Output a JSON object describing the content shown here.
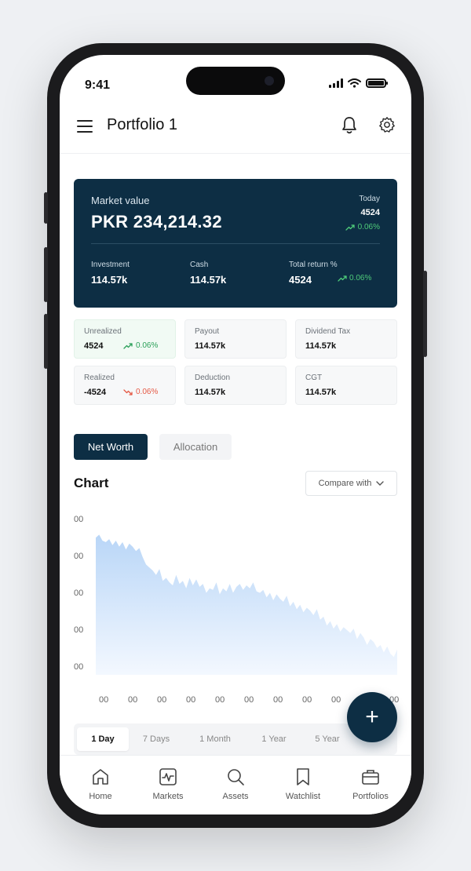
{
  "status_bar": {
    "time": "9:41"
  },
  "header": {
    "title": "Portfolio 1"
  },
  "market_card": {
    "label": "Market value",
    "value": "PKR 234,214.32",
    "today_label": "Today",
    "today_value": "4524",
    "today_change": "0.06%",
    "investment_label": "Investment",
    "investment_value": "114.57k",
    "cash_label": "Cash",
    "cash_value": "114.57k",
    "total_return_label": "Total return %",
    "total_return_value": "4524",
    "total_return_change": "0.06%"
  },
  "stats": [
    {
      "label": "Unrealized",
      "value": "4524",
      "change": "0.06%",
      "trend": "up"
    },
    {
      "label": "Payout",
      "value": "114.57k"
    },
    {
      "label": "Dividend Tax",
      "value": "114.57k"
    },
    {
      "label": "Realized",
      "value": "-4524",
      "change": "0.06%",
      "trend": "down"
    },
    {
      "label": "Deduction",
      "value": "114.57k"
    },
    {
      "label": "CGT",
      "value": "114.57k"
    }
  ],
  "tabs": {
    "net_worth": "Net Worth",
    "allocation": "Allocation"
  },
  "chart_section": {
    "title": "Chart",
    "compare_label": "Compare with"
  },
  "chart_data": {
    "type": "area",
    "y_ticks": [
      "00",
      "00",
      "00",
      "00",
      "00"
    ],
    "x_ticks": [
      "00",
      "00",
      "00",
      "00",
      "00",
      "00",
      "00",
      "00",
      "00",
      "00",
      "00"
    ],
    "values": [
      92,
      94,
      90,
      89,
      91,
      87,
      90,
      86,
      89,
      84,
      88,
      86,
      83,
      85,
      79,
      74,
      72,
      70,
      67,
      71,
      63,
      65,
      62,
      60,
      67,
      61,
      63,
      58,
      65,
      60,
      64,
      59,
      61,
      55,
      58,
      57,
      62,
      54,
      58,
      56,
      61,
      55,
      59,
      61,
      57,
      60,
      58,
      62,
      56,
      55,
      57,
      52,
      55,
      50,
      54,
      51,
      49,
      53,
      46,
      49,
      44,
      47,
      42,
      45,
      43,
      40,
      44,
      37,
      39,
      33,
      36,
      31,
      34,
      29,
      32,
      30,
      28,
      31,
      24,
      28,
      25,
      20,
      24,
      22,
      18,
      20,
      15,
      19,
      14,
      12,
      17
    ],
    "ylim": [
      0,
      100
    ],
    "grid": false,
    "colors": {
      "fill_top": "#b9d6f7",
      "fill_bottom": "#f3f8ff"
    }
  },
  "periods": [
    "1 Day",
    "7 Days",
    "1 Month",
    "1 Year",
    "5 Year"
  ],
  "fab_label": "+",
  "bottom_nav": [
    {
      "label": "Home",
      "icon": "home-icon"
    },
    {
      "label": "Markets",
      "icon": "markets-icon"
    },
    {
      "label": "Assets",
      "icon": "search-icon"
    },
    {
      "label": "Watchlist",
      "icon": "bookmark-icon"
    },
    {
      "label": "Portfolios",
      "icon": "briefcase-icon"
    }
  ],
  "colors": {
    "brand_dark": "#0d2e44",
    "positive": "#2ca05a",
    "negative": "#e55a46"
  }
}
